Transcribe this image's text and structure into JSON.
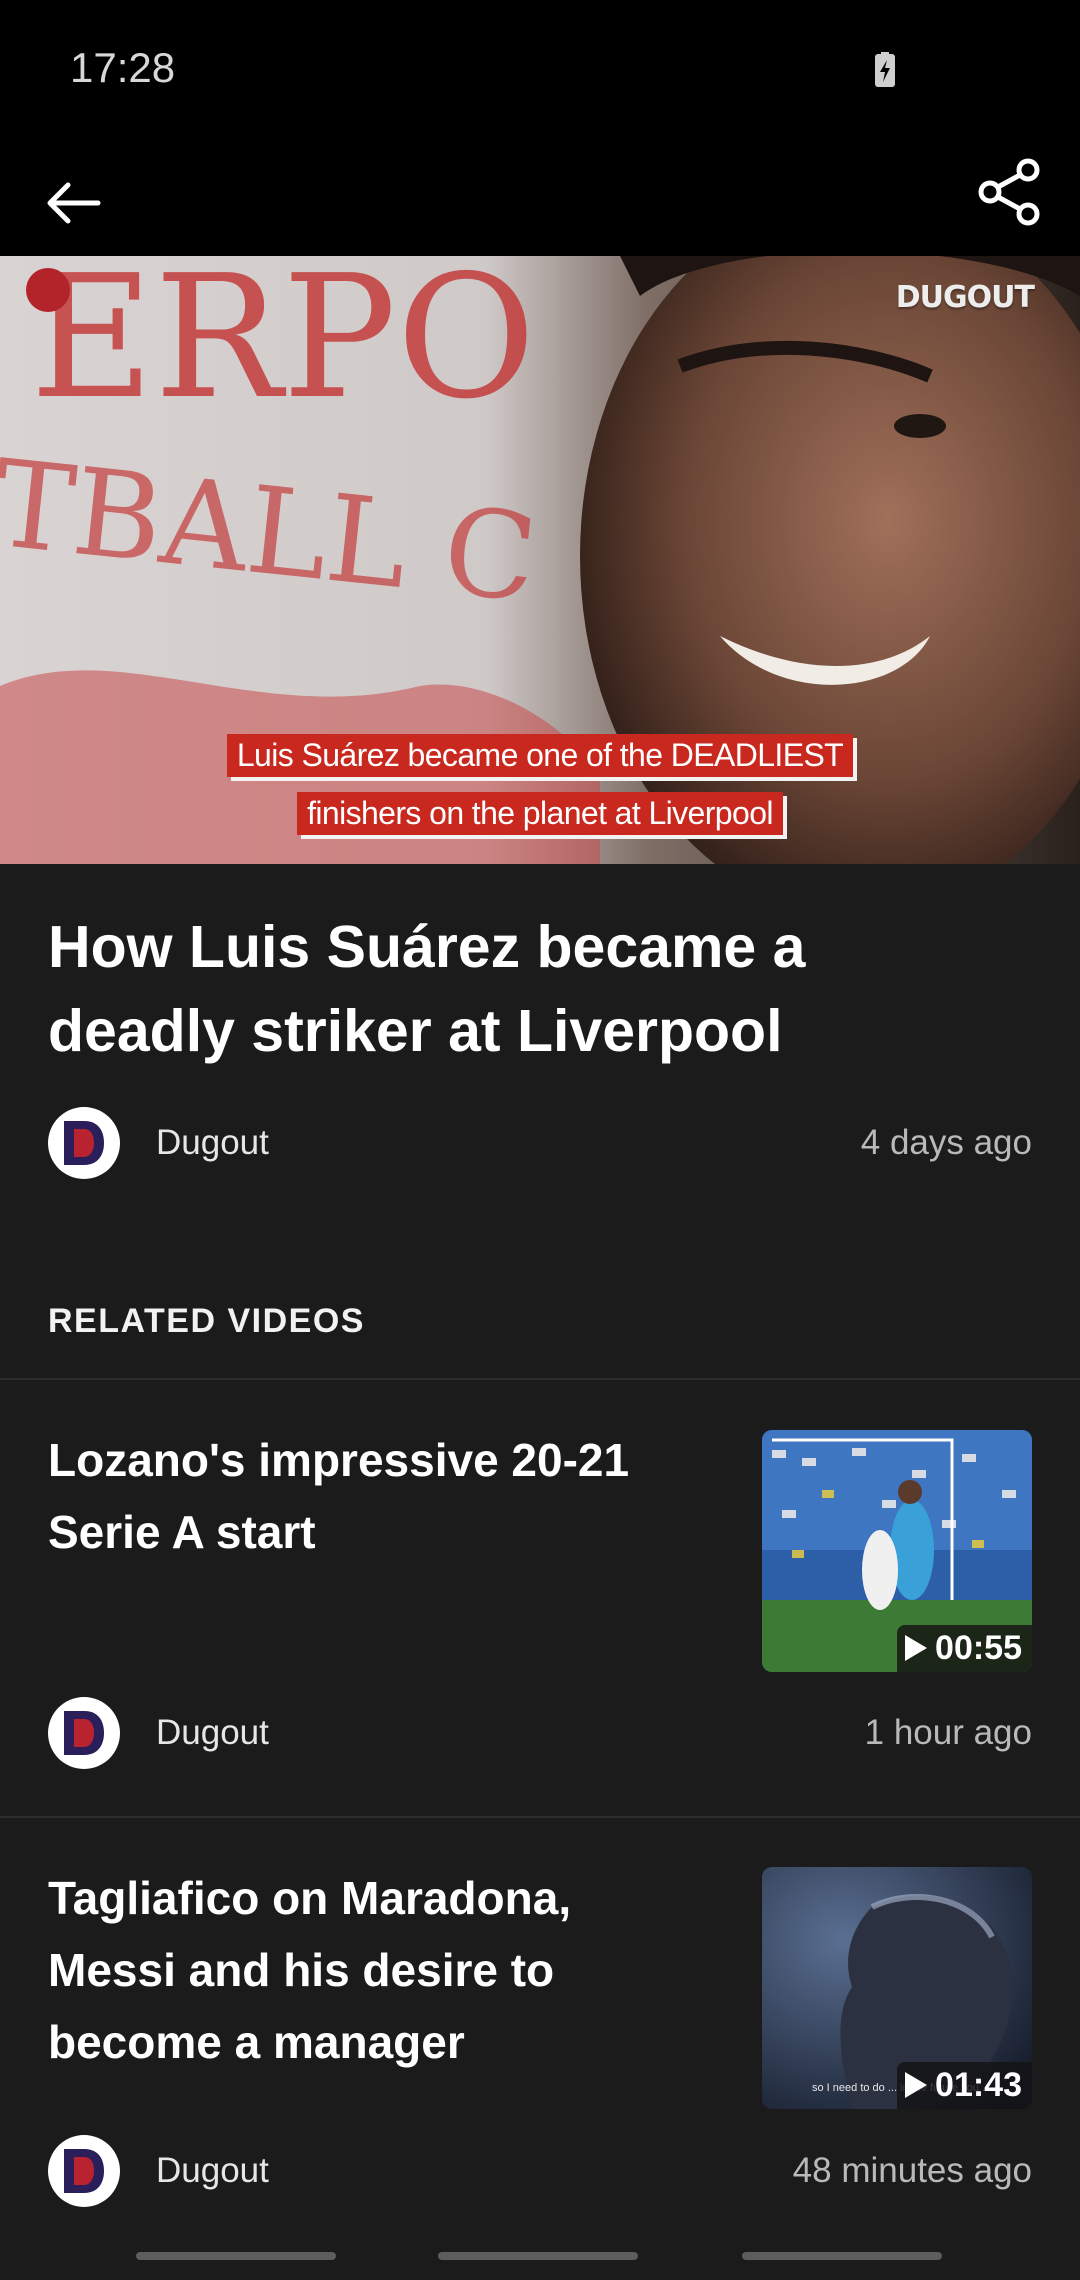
{
  "status_bar": {
    "time": "17:28"
  },
  "hero": {
    "brand": "DUGOUT",
    "caption_line1": "Luis Suárez became one of the DEADLIEST",
    "caption_line2": "finishers on the planet at Liverpool",
    "background_text": "ERPO TBALL C"
  },
  "article": {
    "title_line1": "How Luis Suárez became a",
    "title_line2": "deadly striker at Liverpool",
    "author": "Dugout",
    "time_ago": "4 days ago"
  },
  "related": {
    "section_title": "RELATED VIDEOS",
    "items": [
      {
        "title_line1": "Lozano's impressive 20-21",
        "title_line2": "Serie A start",
        "author": "Dugout",
        "time_ago": "1 hour ago",
        "duration": "00:55"
      },
      {
        "title_line1": "Tagliafico on Maradona,",
        "title_line2": "Messi and his desire to",
        "title_line3": "become a manager",
        "author": "Dugout",
        "time_ago": "48 minutes ago",
        "duration": "01:43",
        "subtitle_overlay": "so I need to do ... in the future you ..."
      }
    ]
  },
  "colors": {
    "background": "#1b1b1c",
    "accent_red": "#c8281e",
    "bars": "#000000"
  }
}
